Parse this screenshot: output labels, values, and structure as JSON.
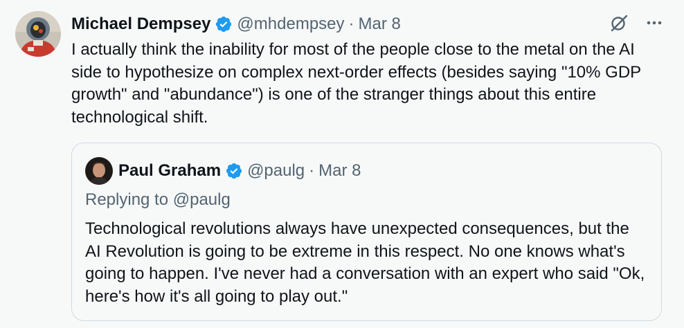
{
  "tweet": {
    "author_name": "Michael Dempsey",
    "author_handle": "@mhdempsey",
    "separator": "·",
    "date": "Mar 8",
    "verified_icon": "verified-badge-icon",
    "actions": {
      "grok_icon": "grok-icon",
      "more_icon": "more-options-icon"
    },
    "text": "I actually think the inability for most of the people close to the metal on the AI side to hypothesize on complex next-order effects (besides saying \"10% GDP growth\" and \"abundance\") is one of the stranger things about this entire technological shift."
  },
  "quote": {
    "author_name": "Paul Graham",
    "author_handle": "@paulg",
    "separator": "·",
    "date": "Mar 8",
    "replying_to": "Replying to @paulg",
    "text": "Technological revolutions always have unexpected consequences, but the AI Revolution is going to be extreme in this respect. No one knows what's going to happen. I've never had a conversation with an expert who said \"Ok, here's how it's all going to play out.\""
  },
  "colors": {
    "background": "#f7f9f9",
    "text": "#0f1419",
    "secondary_text": "#536471",
    "verified_blue": "#1d9bf0",
    "border": "#cfd9de"
  }
}
